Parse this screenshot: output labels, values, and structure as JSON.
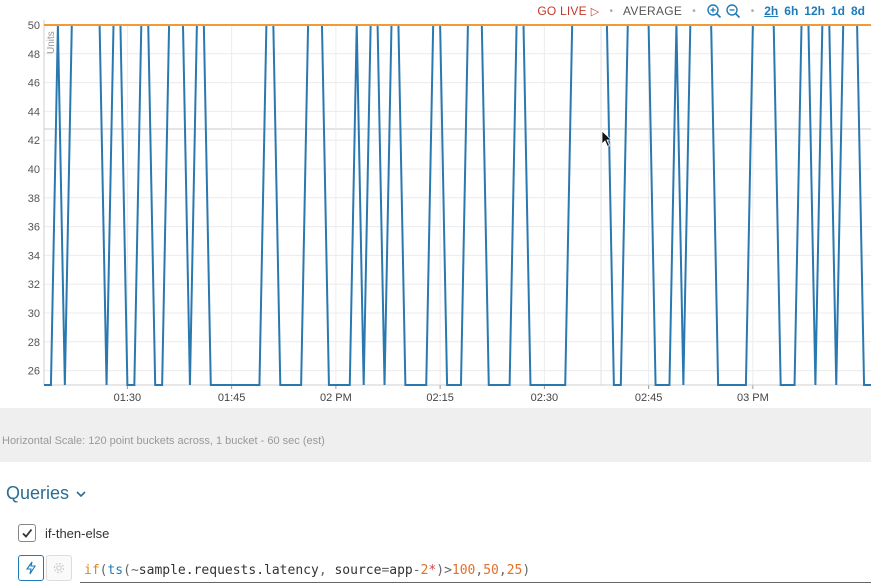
{
  "toolbar": {
    "go_live": "GO LIVE",
    "go_live_icon": "play-outline-icon",
    "summarization": "AVERAGE",
    "zoom_in_icon": "zoom-in-icon",
    "zoom_out_icon": "zoom-out-icon",
    "ranges": [
      "2h",
      "6h",
      "12h",
      "1d",
      "8d"
    ],
    "active_range": "2h"
  },
  "chart_data": {
    "type": "line",
    "ylabel": "Units",
    "ylim": [
      25,
      50
    ],
    "y_ticks": [
      26,
      28,
      30,
      32,
      34,
      36,
      38,
      40,
      42,
      44,
      46,
      48,
      50
    ],
    "x_ticks": [
      "01:30",
      "01:45",
      "02 PM",
      "02:15",
      "02:30",
      "02:45",
      "03 PM"
    ],
    "x_start_time": "01:18",
    "x_end_time": "03:19",
    "grid": true,
    "colors": {
      "series_primary": "#2a78b0",
      "threshold": "#f29a38"
    },
    "series": [
      {
        "values": [
          25,
          25,
          50,
          25,
          50,
          50,
          50,
          50,
          50,
          25,
          50,
          50,
          25,
          25,
          50,
          50,
          25,
          25,
          50,
          50,
          50,
          25,
          50,
          50,
          25,
          25,
          25,
          25,
          25,
          25,
          25,
          25,
          50,
          50,
          25,
          25,
          25,
          25,
          50,
          50,
          50,
          25,
          25,
          25,
          25,
          50,
          25,
          50,
          50,
          25,
          50,
          50,
          25,
          25,
          25,
          25,
          50,
          50,
          25,
          25,
          25,
          50,
          50,
          50,
          25,
          25,
          25,
          25,
          50,
          50,
          25,
          25,
          25,
          25,
          25,
          25,
          50,
          50,
          50,
          50,
          50,
          50,
          25,
          25,
          50,
          50,
          50,
          50,
          25,
          25,
          25,
          50,
          25,
          50,
          50,
          50,
          50,
          25,
          25,
          25,
          25,
          25,
          50,
          50,
          50,
          50,
          25,
          25,
          25,
          50,
          50,
          25,
          50,
          50,
          25,
          50,
          50,
          50,
          25,
          25
        ]
      },
      {
        "values": [
          50,
          50,
          50,
          50,
          50,
          50,
          50,
          50,
          50,
          50,
          50,
          50,
          50,
          50,
          50,
          50,
          50,
          50,
          50,
          50,
          50,
          50,
          50,
          50,
          50,
          50,
          50,
          50,
          50,
          50,
          50,
          50,
          50,
          50,
          50,
          50,
          50,
          50,
          50,
          50,
          50,
          50,
          50,
          50,
          50,
          50,
          50,
          50,
          50,
          50,
          50,
          50,
          50,
          50,
          50,
          50,
          50,
          50,
          50,
          50,
          50,
          50,
          50,
          50,
          50,
          50,
          50,
          50,
          50,
          50,
          50,
          50,
          50,
          50,
          50,
          50,
          50,
          50,
          50,
          50,
          50,
          50,
          50,
          50,
          50,
          50,
          50,
          50,
          50,
          50,
          50,
          50,
          50,
          50,
          50,
          50,
          50,
          50,
          50,
          50,
          50,
          50,
          50,
          50,
          50,
          50,
          50,
          50,
          50,
          50,
          50,
          50,
          50,
          50,
          50,
          50,
          50,
          50,
          50,
          50
        ]
      }
    ]
  },
  "horizontal_scale_text": "Horizontal Scale: 120 point buckets across, 1 bucket - 60 sec (est)",
  "queries": {
    "header": "Queries",
    "chevron_icon": "chevron-down-icon",
    "items": [
      {
        "name": "if-then-else",
        "checked": true,
        "expression": "if(ts(~sample.requests.latency, source=app-2*)>100,50,25)"
      }
    ]
  }
}
